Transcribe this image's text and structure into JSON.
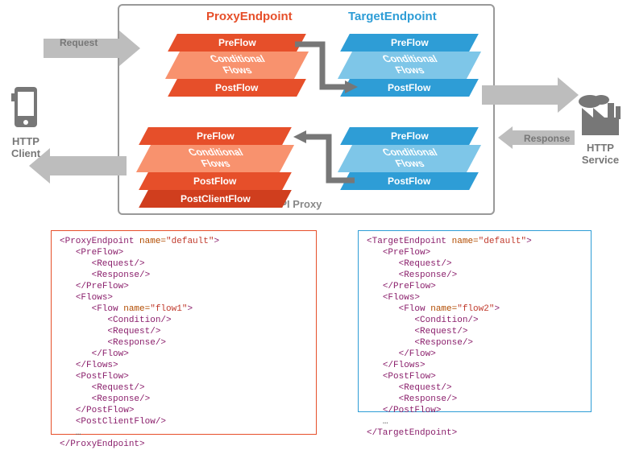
{
  "titles": {
    "proxy": "ProxyEndpoint",
    "target": "TargetEndpoint",
    "api": "API Proxy"
  },
  "arrows": {
    "request": "Request",
    "response": "Response"
  },
  "client": {
    "line1": "HTTP",
    "line2": "Client"
  },
  "service": {
    "line1": "HTTP",
    "line2": "Service"
  },
  "flows": {
    "pre": "PreFlow",
    "cond1": "Conditional",
    "cond2": "Flows",
    "post": "PostFlow",
    "postclient": "PostClientFlow"
  },
  "code_proxy": {
    "open": "<ProxyEndpoint name=\"default\">",
    "preflow_open": "<PreFlow>",
    "request": "<Request/>",
    "response": "<Response/>",
    "preflow_close": "</PreFlow>",
    "flows_open": "<Flows>",
    "flow_open": "<Flow name=\"flow1\">",
    "condition": "<Condition/>",
    "flow_close": "</Flow>",
    "flows_close": "</Flows>",
    "postflow_open": "<PostFlow>",
    "postflow_close": "</PostFlow>",
    "postclient": "<PostClientFlow/>",
    "dots": "…",
    "close": "</ProxyEndpoint>"
  },
  "code_target": {
    "open": "<TargetEndpoint name=\"default\">",
    "preflow_open": "<PreFlow>",
    "request": "<Request/>",
    "response": "<Response/>",
    "preflow_close": "</PreFlow>",
    "flows_open": "<Flows>",
    "flow_open": "<Flow name=\"flow2\">",
    "condition": "<Condition/>",
    "flow_close": "</Flow>",
    "flows_close": "</Flows>",
    "postflow_open": "<PostFlow>",
    "postflow_close": "</PostFlow>",
    "dots": "…",
    "close": "</TargetEndpoint>"
  }
}
